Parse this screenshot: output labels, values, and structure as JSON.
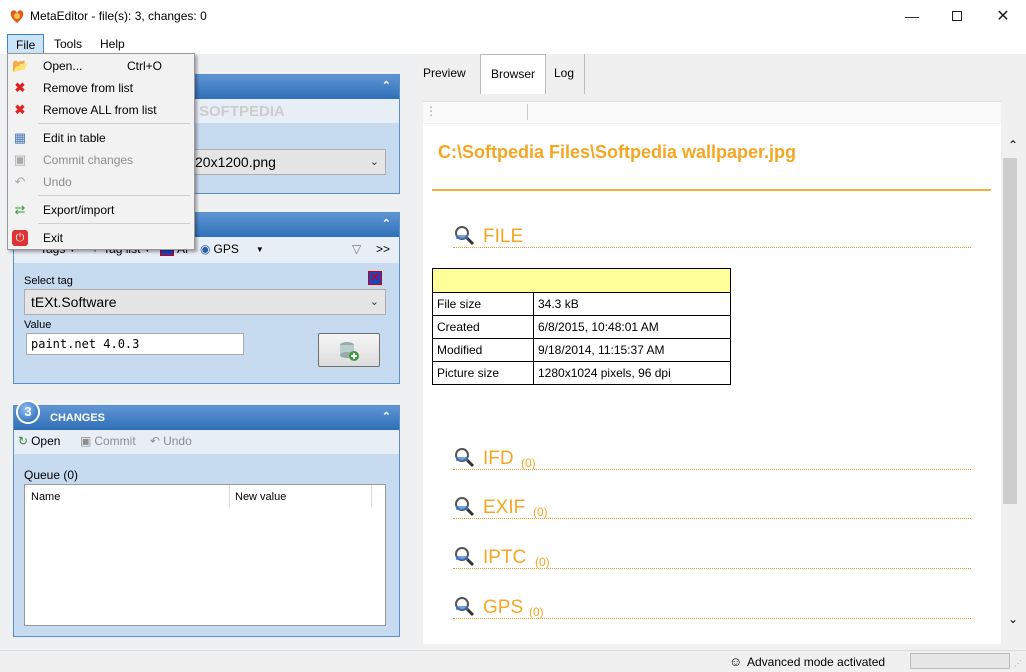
{
  "window": {
    "title": "MetaEditor - file(s): 3, changes: 0"
  },
  "menubar": {
    "file": "File",
    "tools": "Tools",
    "help": "Help"
  },
  "file_menu": {
    "open": "Open...",
    "open_shortcut": "Ctrl+O",
    "remove": "Remove from list",
    "remove_all": "Remove ALL from list",
    "edit_table": "Edit in table",
    "commit": "Commit changes",
    "undo": "Undo",
    "export_import": "Export/import",
    "exit": "Exit"
  },
  "panel1": {
    "file_value": "20x1200.png",
    "watermark": "SOFTPEDIA"
  },
  "panel2": {
    "toolbar": {
      "tags": "Tags",
      "tag_list": "Tag list",
      "af": "AF",
      "gps": "GPS",
      "more": ">>"
    },
    "select_tag_label": "Select tag",
    "select_tag_value": "tEXt.Software",
    "value_label": "Value",
    "value": "paint.net 4.0.3"
  },
  "panel3": {
    "number": "3",
    "title": "CHANGES",
    "toolbar": {
      "open": "Open",
      "commit": "Commit",
      "undo": "Undo"
    },
    "queue_label": "Queue (0)",
    "columns": [
      "Name",
      "New value"
    ]
  },
  "tabs": [
    "Preview",
    "Browser",
    "Log"
  ],
  "browser": {
    "path": "C:\\Softpedia Files\\Softpedia wallpaper.jpg",
    "file_section": "FILE",
    "file_table": [
      [
        "File size",
        "34.3 kB"
      ],
      [
        "Created",
        "6/8/2015, 10:48:01 AM"
      ],
      [
        "Modified",
        "9/18/2014, 11:15:37 AM"
      ],
      [
        "Picture size",
        "1280x1024 pixels, 96 dpi"
      ]
    ],
    "sections": [
      {
        "name": "IFD",
        "count": "(0)"
      },
      {
        "name": "EXIF",
        "count": "(0)"
      },
      {
        "name": "IPTC",
        "count": "(0)"
      },
      {
        "name": "GPS",
        "count": "(0)"
      }
    ]
  },
  "status": {
    "text": "Advanced mode activated"
  },
  "colors": {
    "accent": "#f5a623",
    "panel_head": "#2f6fb8",
    "table_header": "#ffff99"
  }
}
